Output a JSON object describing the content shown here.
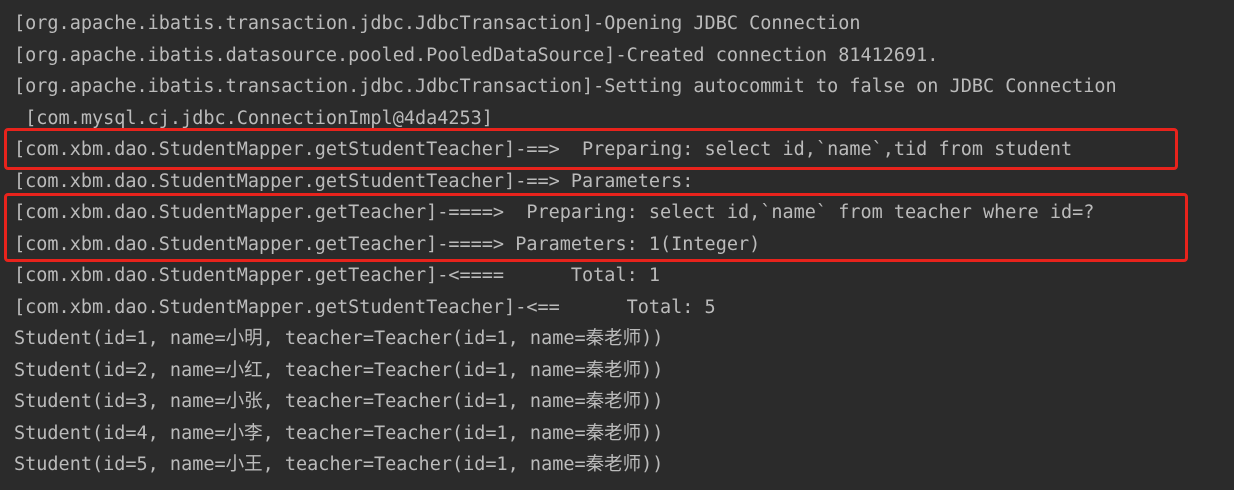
{
  "console": {
    "lines": [
      "[org.apache.ibatis.transaction.jdbc.JdbcTransaction]-Opening JDBC Connection",
      "[org.apache.ibatis.datasource.pooled.PooledDataSource]-Created connection 81412691.",
      "[org.apache.ibatis.transaction.jdbc.JdbcTransaction]-Setting autocommit to false on JDBC Connection",
      " [com.mysql.cj.jdbc.ConnectionImpl@4da4253]",
      "[com.xbm.dao.StudentMapper.getStudentTeacher]-==>  Preparing: select id,`name`,tid from student",
      "[com.xbm.dao.StudentMapper.getStudentTeacher]-==> Parameters: ",
      "[com.xbm.dao.StudentMapper.getTeacher]-====>  Preparing: select id,`name` from teacher where id=?",
      "[com.xbm.dao.StudentMapper.getTeacher]-====> Parameters: 1(Integer)",
      "[com.xbm.dao.StudentMapper.getTeacher]-<====      Total: 1",
      "[com.xbm.dao.StudentMapper.getStudentTeacher]-<==      Total: 5",
      "Student(id=1, name=小明, teacher=Teacher(id=1, name=秦老师))",
      "Student(id=2, name=小红, teacher=Teacher(id=1, name=秦老师))",
      "Student(id=3, name=小张, teacher=Teacher(id=1, name=秦老师))",
      "Student(id=4, name=小李, teacher=Teacher(id=1, name=秦老师))",
      "Student(id=5, name=小王, teacher=Teacher(id=1, name=秦老师))"
    ]
  },
  "colors": {
    "background": "#2b2b2b",
    "text": "#bbbbbb",
    "highlight_border": "#e8231c"
  }
}
